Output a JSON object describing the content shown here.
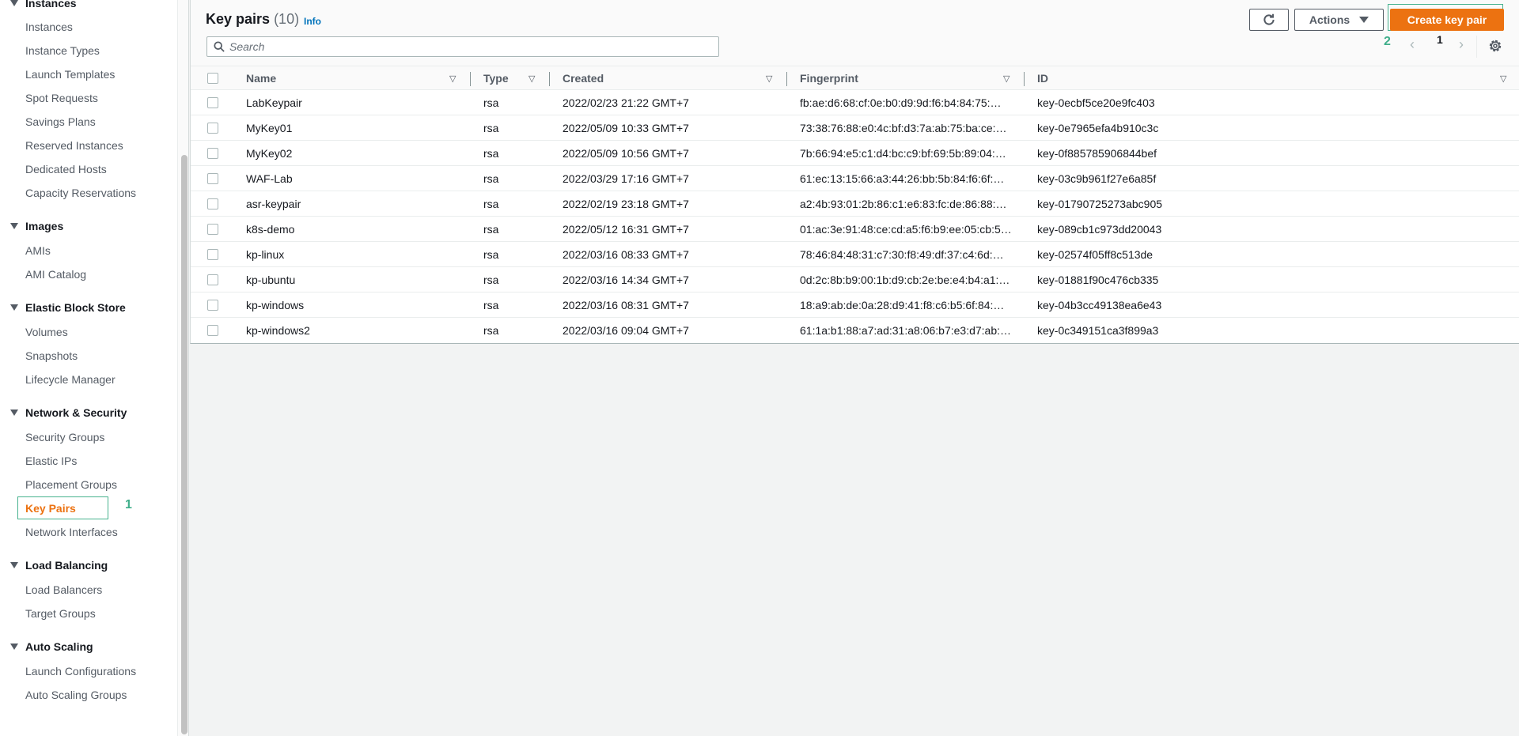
{
  "sidebar": {
    "sections": [
      {
        "title": "Instances",
        "items": [
          "Instances",
          "Instance Types",
          "Launch Templates",
          "Spot Requests",
          "Savings Plans",
          "Reserved Instances",
          "Dedicated Hosts",
          "Capacity Reservations"
        ]
      },
      {
        "title": "Images",
        "items": [
          "AMIs",
          "AMI Catalog"
        ]
      },
      {
        "title": "Elastic Block Store",
        "items": [
          "Volumes",
          "Snapshots",
          "Lifecycle Manager"
        ]
      },
      {
        "title": "Network & Security",
        "items": [
          "Security Groups",
          "Elastic IPs",
          "Placement Groups",
          "Key Pairs",
          "Network Interfaces"
        ]
      },
      {
        "title": "Load Balancing",
        "items": [
          "Load Balancers",
          "Target Groups"
        ]
      },
      {
        "title": "Auto Scaling",
        "items": [
          "Launch Configurations",
          "Auto Scaling Groups"
        ]
      }
    ],
    "active_item": "Key Pairs",
    "annotation": "1"
  },
  "header": {
    "title": "Key pairs",
    "count": "(10)",
    "info_label": "Info",
    "actions_label": "Actions",
    "create_label": "Create key pair",
    "create_annotation": "2",
    "search_placeholder": "Search",
    "search_value": "",
    "page": "1",
    "prev_icon": "chevron-left-icon",
    "next_icon": "chevron-right-icon",
    "refresh_icon": "refresh-icon",
    "settings_icon": "gear-icon"
  },
  "table": {
    "columns": [
      "Name",
      "Type",
      "Created",
      "Fingerprint",
      "ID"
    ],
    "rows": [
      {
        "name": "LabKeypair",
        "type": "rsa",
        "created": "2022/02/23 21:22 GMT+7",
        "fingerprint": "fb:ae:d6:68:cf:0e:b0:d9:9d:f6:b4:84:75:…",
        "id": "key-0ecbf5ce20e9fc403"
      },
      {
        "name": "MyKey01",
        "type": "rsa",
        "created": "2022/05/09 10:33 GMT+7",
        "fingerprint": "73:38:76:88:e0:4c:bf:d3:7a:ab:75:ba:ce:…",
        "id": "key-0e7965efa4b910c3c"
      },
      {
        "name": "MyKey02",
        "type": "rsa",
        "created": "2022/05/09 10:56 GMT+7",
        "fingerprint": "7b:66:94:e5:c1:d4:bc:c9:bf:69:5b:89:04:…",
        "id": "key-0f885785906844bef"
      },
      {
        "name": "WAF-Lab",
        "type": "rsa",
        "created": "2022/03/29 17:16 GMT+7",
        "fingerprint": "61:ec:13:15:66:a3:44:26:bb:5b:84:f6:6f:…",
        "id": "key-03c9b961f27e6a85f"
      },
      {
        "name": "asr-keypair",
        "type": "rsa",
        "created": "2022/02/19 23:18 GMT+7",
        "fingerprint": "a2:4b:93:01:2b:86:c1:e6:83:fc:de:86:88:…",
        "id": "key-01790725273abc905"
      },
      {
        "name": "k8s-demo",
        "type": "rsa",
        "created": "2022/05/12 16:31 GMT+7",
        "fingerprint": "01:ac:3e:91:48:ce:cd:a5:f6:b9:ee:05:cb:5…",
        "id": "key-089cb1c973dd20043"
      },
      {
        "name": "kp-linux",
        "type": "rsa",
        "created": "2022/03/16 08:33 GMT+7",
        "fingerprint": "78:46:84:48:31:c7:30:f8:49:df:37:c4:6d:…",
        "id": "key-02574f05ff8c513de"
      },
      {
        "name": "kp-ubuntu",
        "type": "rsa",
        "created": "2022/03/16 14:34 GMT+7",
        "fingerprint": "0d:2c:8b:b9:00:1b:d9:cb:2e:be:e4:b4:a1:…",
        "id": "key-01881f90c476cb335"
      },
      {
        "name": "kp-windows",
        "type": "rsa",
        "created": "2022/03/16 08:31 GMT+7",
        "fingerprint": "18:a9:ab:de:0a:28:d9:41:f8:c6:b5:6f:84:…",
        "id": "key-04b3cc49138ea6e43"
      },
      {
        "name": "kp-windows2",
        "type": "rsa",
        "created": "2022/03/16 09:04 GMT+7",
        "fingerprint": "61:1a:b1:88:a7:ad:31:a8:06:b7:e3:d7:ab:…",
        "id": "key-0c349151ca3f899a3"
      }
    ]
  },
  "colors": {
    "accent": "#ec7211",
    "annotation": "#3fae8a",
    "link": "#0073bb"
  }
}
